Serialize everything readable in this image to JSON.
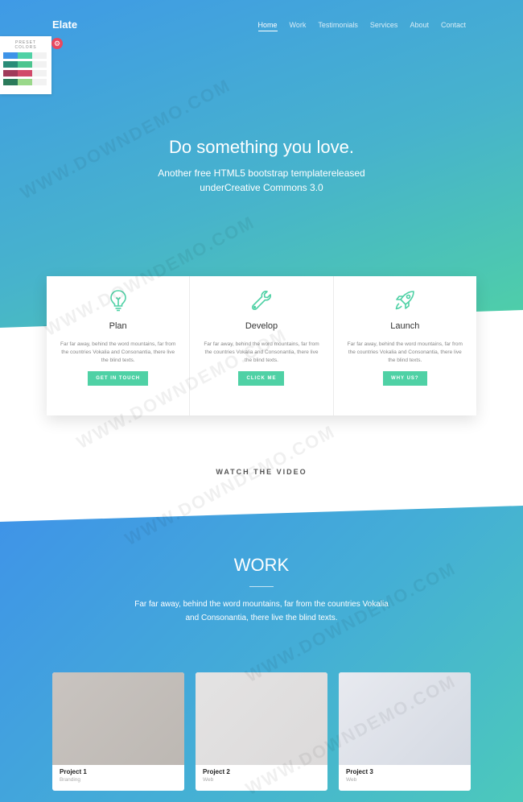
{
  "brand": "Elate",
  "nav": [
    "Home",
    "Work",
    "Testimonials",
    "Services",
    "About",
    "Contact"
  ],
  "preset": {
    "title_line1": "PRESET",
    "title_line2": "COLORS",
    "swatches": [
      [
        "#3d93e8",
        "#4fd1a5"
      ],
      [
        "#2a8c78",
        "#4cc58f"
      ],
      [
        "#a03a5a",
        "#d14a6a"
      ],
      [
        "#2b7a5a",
        "#9ad88a"
      ]
    ],
    "toggle_color": "#e8485f"
  },
  "hero": {
    "title": "Do something you love.",
    "subtitle": "Another free HTML5 bootstrap templatereleased underCreative Commons 3.0"
  },
  "features": [
    {
      "icon": "lightbulb-icon",
      "title": "Plan",
      "text": "Far far away, behind the word mountains, far from the countries Vokalia and Consonantia, there live the blind texts.",
      "button": "GET IN TOUCH"
    },
    {
      "icon": "wrench-icon",
      "title": "Develop",
      "text": "Far far away, behind the word mountains, far from the countries Vokalia and Consonantia, there live the blind texts.",
      "button": "CLICK ME"
    },
    {
      "icon": "rocket-icon",
      "title": "Launch",
      "text": "Far far away, behind the word mountains, far from the countries Vokalia and Consonantia, there live the blind texts.",
      "button": "WHY US?"
    }
  ],
  "watch_video": "WATCH THE VIDEO",
  "work": {
    "title": "WORK",
    "subtitle": "Far far away, behind the word mountains, far from the countries Vokalia and Consonantia, there live the blind texts.",
    "projects": [
      {
        "name": "Project 1",
        "category": "Branding"
      },
      {
        "name": "Project 2",
        "category": "Web"
      },
      {
        "name": "Project 3",
        "category": "Web"
      }
    ]
  },
  "watermark": "WWW.DOWNDEMO.COM",
  "colors": {
    "accent": "#4fd1a5",
    "gradient_start": "#3f9ae6",
    "gradient_end": "#4fd0a6"
  }
}
